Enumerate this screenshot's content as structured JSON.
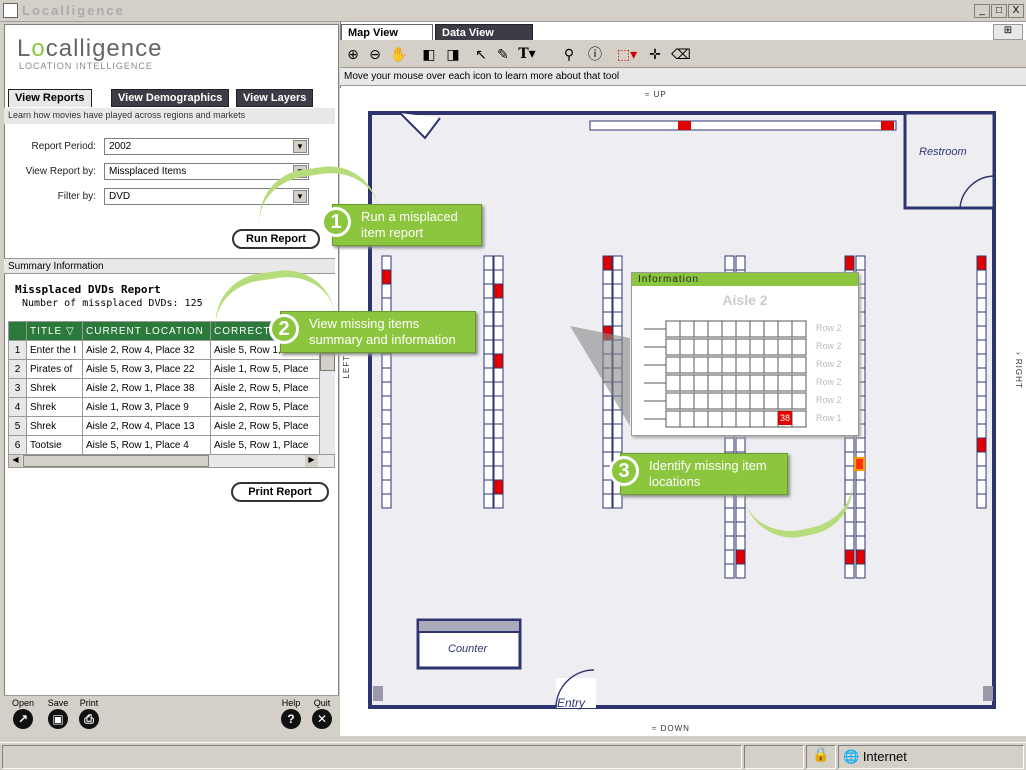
{
  "window": {
    "title": "Localligence",
    "min": "_",
    "max": "□",
    "close": "X"
  },
  "app": {
    "logo_pre": "L",
    "logo_o": "o",
    "logo_post": "calligence",
    "logo_sub": "LOCATION INTELLIGENCE"
  },
  "left_tabs": [
    "View Reports",
    "View Demographics",
    "View Layers"
  ],
  "left_hint": "Learn how movies have played across regions and markets",
  "form": {
    "period_label": "Report Period:",
    "period_value": "2002",
    "viewby_label": "View Report by:",
    "viewby_value": "Missplaced Items",
    "filter_label": "Filter by:",
    "filter_value": "DVD",
    "run_label": "Run Report"
  },
  "summary": {
    "header": "Summary Information",
    "report_title": "Missplaced DVDs Report",
    "count_text": "Number of missplaced DVDs: 125",
    "print_label": "Print Report",
    "columns": [
      "TITLE",
      "CURRENT LOCATION",
      "CORRECT"
    ],
    "rows": [
      [
        "1",
        "Enter the I",
        "Aisle 2, Row 4, Place 32",
        "Aisle 5, Row 1, Place"
      ],
      [
        "2",
        "Pirates of",
        "Aisle 5, Row 3, Place 22",
        "Aisle 1, Row 5, Place"
      ],
      [
        "3",
        "Shrek",
        "Aisle 2, Row 1, Place 38",
        "Aisle 2, Row 5, Place"
      ],
      [
        "4",
        "Shrek",
        "Aisle 1, Row 3, Place 9",
        "Aisle 2, Row 5, Place"
      ],
      [
        "5",
        "Shrek",
        "Aisle 2, Row 4, Place 13",
        "Aisle 2, Row 5, Place"
      ],
      [
        "6",
        "Tootsie",
        "Aisle 5, Row 1, Place 4",
        "Aisle 5, Row 1, Place"
      ]
    ]
  },
  "bottom_buttons": [
    {
      "label": "Open",
      "icon": "open-icon"
    },
    {
      "label": "Save",
      "icon": "save-icon"
    },
    {
      "label": "Print",
      "icon": "print-icon"
    },
    {
      "label": "Help",
      "icon": "help-icon"
    },
    {
      "label": "Quit",
      "icon": "quit-icon"
    }
  ],
  "right_tabs": [
    "Map View",
    "Data View"
  ],
  "tool_hint": "Move your mouse over each icon to learn more about that tool",
  "map": {
    "up": "UP",
    "down": "DOWN",
    "left": "LEFT",
    "right": "RIGHT",
    "restroom": "Restroom",
    "counter": "Counter",
    "entry": "Entry",
    "info_title": "Information",
    "info_aisle": "Aisle 2",
    "info_rows": [
      "Row 2",
      "Row 2",
      "Row 2",
      "Row 2",
      "Row 2",
      "Row 1"
    ],
    "info_highlight": "38"
  },
  "callouts": [
    {
      "num": "1",
      "text": "Run a misplaced item report"
    },
    {
      "num": "2",
      "text": "View missing items summary and information"
    },
    {
      "num": "3",
      "text": "Identify missing item locations"
    }
  ],
  "status": {
    "zone": "Internet"
  },
  "colors": {
    "accent": "#8cc63f",
    "wall": "#2e3470",
    "missing": "#e00000",
    "tab_dark": "#3c3c46"
  }
}
